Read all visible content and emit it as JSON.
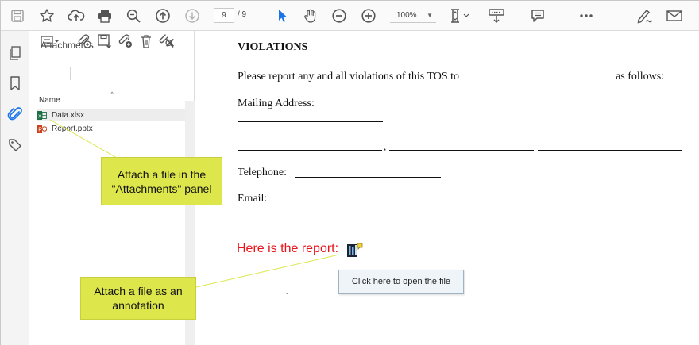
{
  "toolbar": {
    "page_current": "9",
    "page_total": "/ 9",
    "zoom": "100%",
    "icons": [
      "save-icon",
      "bookmark-star-icon",
      "upload-cloud-icon",
      "print-icon",
      "zoom-search-icon",
      "page-up-icon",
      "page-down-icon",
      "select-cursor-icon",
      "hand-pan-icon",
      "zoom-out-icon",
      "zoom-in-icon",
      "fit-page-icon",
      "scroll-mode-icon",
      "comment-icon",
      "more-icon",
      "sign-icon",
      "email-icon"
    ]
  },
  "rail": {
    "icons": [
      "pages-icon",
      "bookmark-icon",
      "attachment-paperclip-icon",
      "tag-icon"
    ]
  },
  "panel": {
    "title": "Attachments",
    "close": "✕",
    "column_header": "Name",
    "sort_caret": "^",
    "files": [
      {
        "name": "Data.xlsx",
        "type": "excel",
        "selected": true
      },
      {
        "name": "Report.pptx",
        "type": "powerpoint",
        "selected": false
      }
    ]
  },
  "document": {
    "heading": "VIOLATIONS",
    "line1_before": "Please report any and all violations of this TOS to",
    "line1_after": "as follows:",
    "mailing_label": "Mailing Address:",
    "comma": ",",
    "telephone_label": "Telephone:",
    "email_label": "Email:",
    "report_text": "Here is the report:",
    "tooltip": "Click here to open the file",
    "dot": "."
  },
  "callouts": {
    "panel_callout": "Attach a file in the \"Attachments\" panel",
    "annotation_callout": "Attach a file as an annotation"
  },
  "colors": {
    "callout_bg": "#dde64a",
    "report_red": "#e8141a",
    "accent_blue": "#1a73e8",
    "tooltip_bg": "#eef4f8"
  }
}
